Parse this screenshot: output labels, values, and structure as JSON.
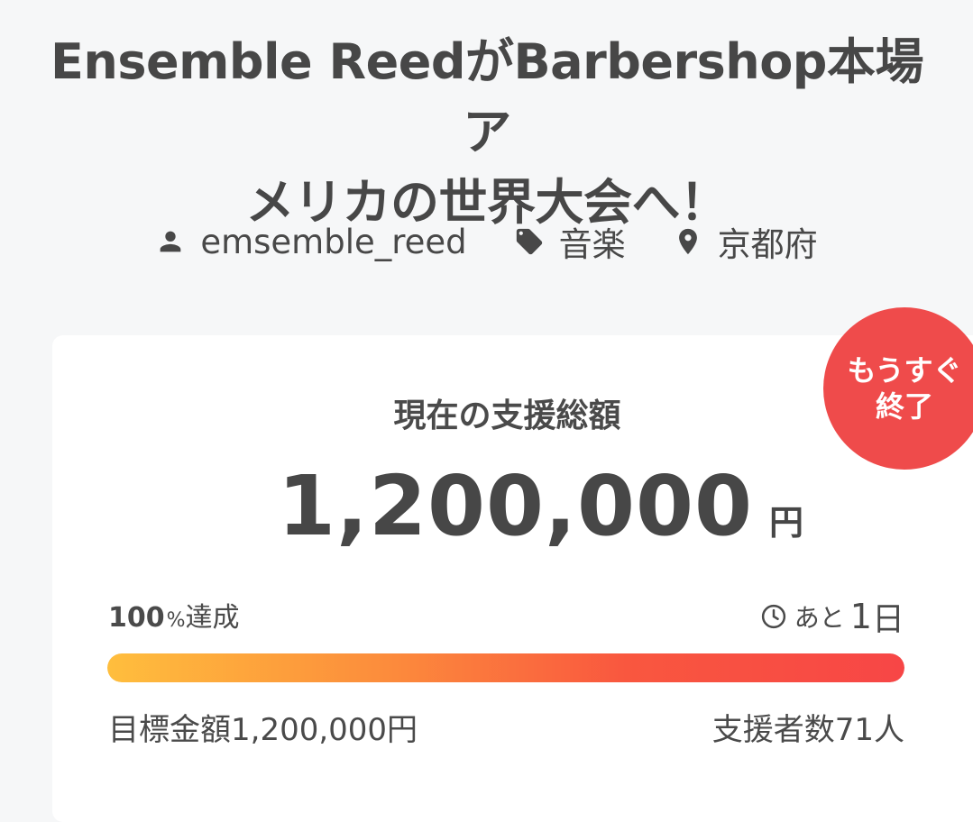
{
  "project": {
    "title_line1": "Ensemble ReedがBarbershop本場ア",
    "title_line2": "メリカの世界大会へ！",
    "owner": "emsemble_reed",
    "category": "音楽",
    "location": "京都府"
  },
  "icons": {
    "owner": "person-icon",
    "category": "tag-icon",
    "location": "map-pin-icon",
    "remaining": "clock-icon"
  },
  "badge": {
    "line1": "もうすぐ",
    "line2": "終了"
  },
  "funding": {
    "label": "現在の支援総額",
    "amount": "1,200,000",
    "currency": "円",
    "achieved_number": "100",
    "achieved_percent_sign": "%",
    "achieved_label": "達成",
    "remaining_prefix": "あと",
    "remaining_value": "1",
    "remaining_unit": "日",
    "goal_text": "目標金額1,200,000円",
    "backers_text": "支援者数71人",
    "progress_percent": 100
  },
  "colors": {
    "badge": "#ef4b4b",
    "progress_start": "#ffbe3d",
    "progress_end": "#f74646",
    "text": "#484848",
    "background": "#f6f7f8",
    "card": "#ffffff"
  }
}
